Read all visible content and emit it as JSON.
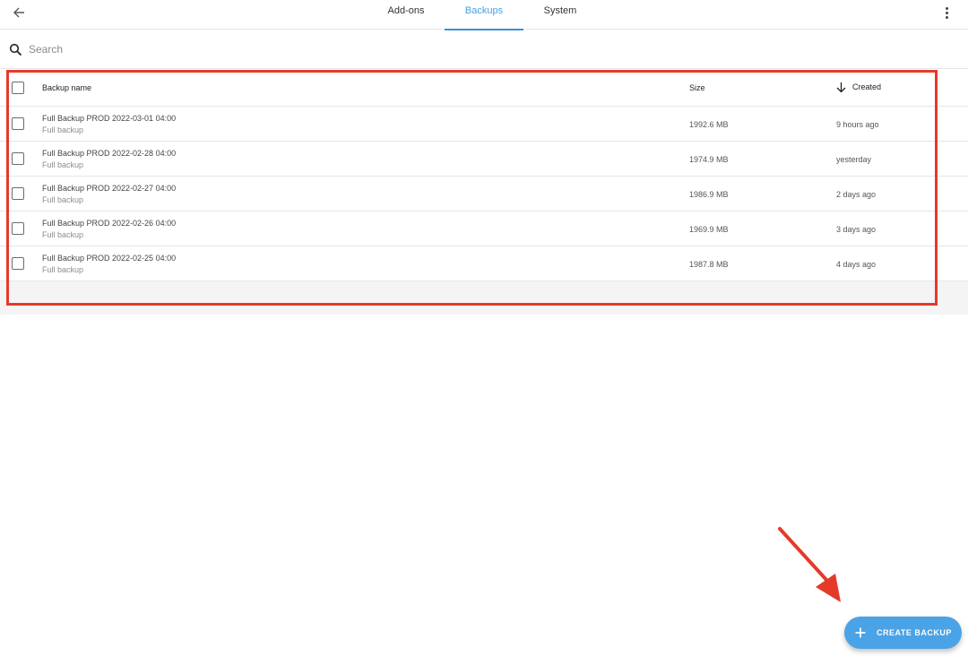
{
  "header": {
    "back_icon": "arrow-left-icon",
    "tabs": [
      {
        "label": "Add-ons",
        "active": false
      },
      {
        "label": "Backups",
        "active": true
      },
      {
        "label": "System",
        "active": false
      }
    ],
    "menu_icon": "more-vertical-icon"
  },
  "search": {
    "placeholder": "Search",
    "value": "",
    "icon": "search-icon"
  },
  "table": {
    "columns": {
      "name": "Backup name",
      "size": "Size",
      "created": "Created"
    },
    "sort": {
      "column": "created",
      "direction": "descending",
      "icon": "arrow-down-icon"
    },
    "rows": [
      {
        "name": "Full Backup PROD 2022-03-01 04:00",
        "type": "Full backup",
        "size": "1992.6 MB",
        "created": "9 hours ago"
      },
      {
        "name": "Full Backup PROD 2022-02-28 04:00",
        "type": "Full backup",
        "size": "1974.9 MB",
        "created": "yesterday"
      },
      {
        "name": "Full Backup PROD 2022-02-27 04:00",
        "type": "Full backup",
        "size": "1986.9 MB",
        "created": "2 days ago"
      },
      {
        "name": "Full Backup PROD 2022-02-26 04:00",
        "type": "Full backup",
        "size": "1969.9 MB",
        "created": "3 days ago"
      },
      {
        "name": "Full Backup PROD 2022-02-25 04:00",
        "type": "Full backup",
        "size": "1987.8 MB",
        "created": "4 days ago"
      }
    ]
  },
  "fab": {
    "label": "CREATE BACKUP",
    "icon": "plus-icon"
  },
  "colors": {
    "accent": "#4aa3e6",
    "active_tab": "#3c8fcf",
    "annotation": "#e53a2a"
  }
}
